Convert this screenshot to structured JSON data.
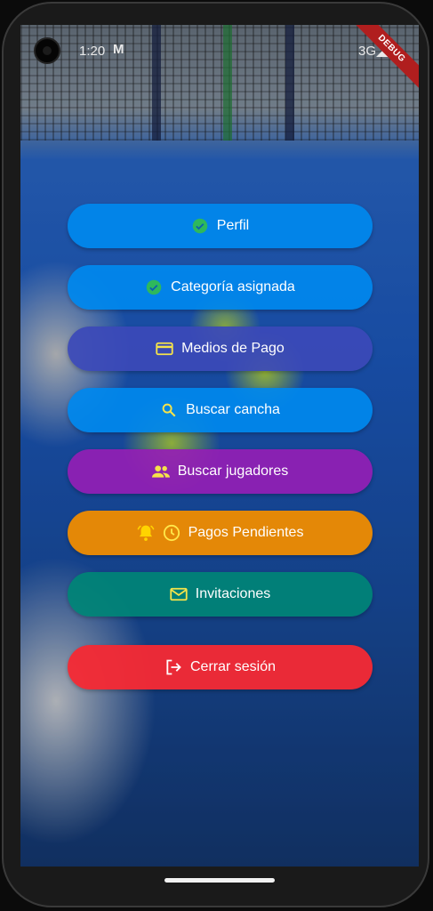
{
  "status_bar": {
    "time": "1:20",
    "mail_glyph": "M",
    "network": "3G",
    "debug_banner": "DEBUG"
  },
  "colors": {
    "blue": "#1e88e5",
    "indigo": "#3949ab",
    "purple": "#8e24aa",
    "orange": "#ef8c00",
    "teal": "#00897b",
    "red": "#f4303a",
    "icon_green": "#2eb85c",
    "icon_yellow": "#f5e34a",
    "icon_orange_bell": "#ffb300"
  },
  "menu": {
    "perfil": {
      "label": "Perfil",
      "icon": "check-circle-icon"
    },
    "categoria": {
      "label": "Categoría asignada",
      "icon": "check-circle-icon"
    },
    "medios_pago": {
      "label": "Medios de Pago",
      "icon": "credit-card-icon"
    },
    "buscar_cancha": {
      "label": "Buscar cancha",
      "icon": "search-icon"
    },
    "buscar_jugadores": {
      "label": "Buscar jugadores",
      "icon": "people-icon"
    },
    "pagos_pendientes": {
      "label": "Pagos Pendientes",
      "icons": [
        "bell-icon",
        "clock-icon"
      ]
    },
    "invitaciones": {
      "label": "Invitaciones",
      "icon": "mail-icon"
    },
    "cerrar_sesion": {
      "label": "Cerrar sesión",
      "icon": "logout-icon"
    }
  }
}
